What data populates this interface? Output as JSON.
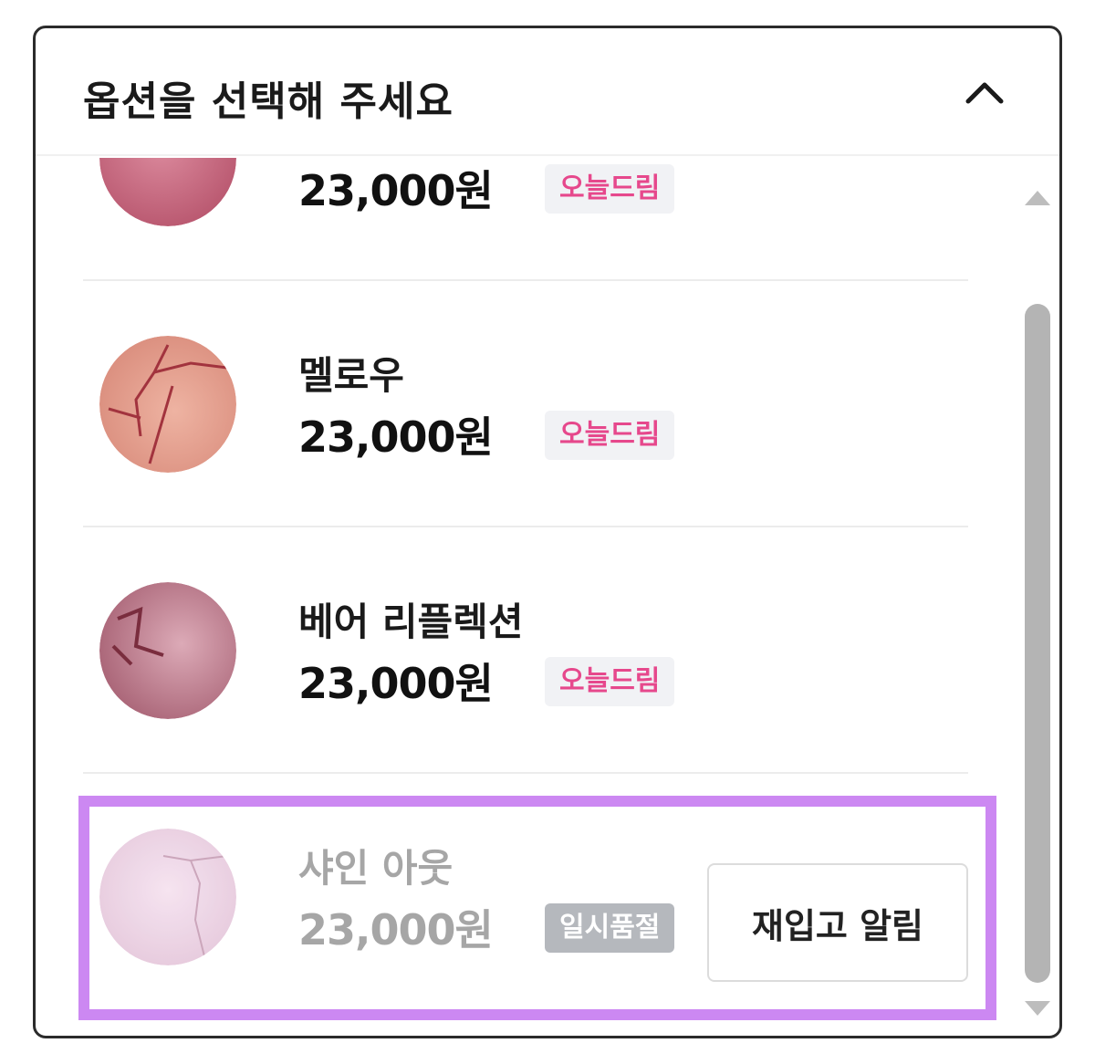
{
  "header": {
    "title": "옵션을 선택해 주세요"
  },
  "options": [
    {
      "name": "",
      "price": "23,000원",
      "badge": "오늘드림",
      "badge_color": "#e6488c",
      "swatch": "#c9677d",
      "sold_out": false
    },
    {
      "name": "멜로우",
      "price": "23,000원",
      "badge": "오늘드림",
      "badge_color": "#e6488c",
      "swatch": "#e29b8c",
      "sold_out": false
    },
    {
      "name": "베어 리플렉션",
      "price": "23,000원",
      "badge": "오늘드림",
      "badge_color": "#e6488c",
      "swatch": "#c7899a",
      "sold_out": false
    },
    {
      "name": "샤인 아웃",
      "price": "23,000원",
      "badge": "일시품절",
      "badge_color": "#b5b8bd",
      "swatch": "#ecd3e6",
      "sold_out": true,
      "action_label": "재입고 알림"
    }
  ],
  "colors": {
    "highlight": "#cc88f2",
    "scroll_thumb": "#b4b4b4"
  },
  "icons": {
    "collapse": "chevron-up-icon",
    "scroll_up": "triangle-up-icon",
    "scroll_down": "triangle-down-icon"
  }
}
